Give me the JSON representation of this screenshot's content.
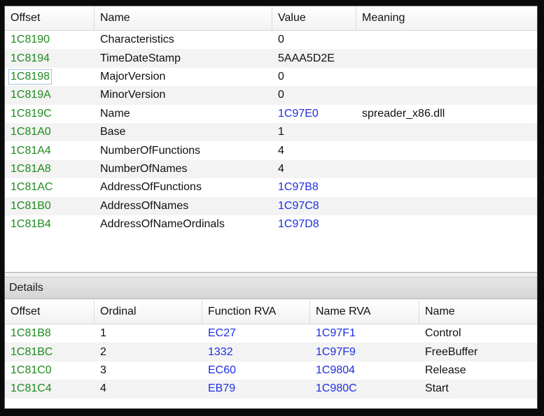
{
  "top_table": {
    "columns": [
      "Offset",
      "Name",
      "Value",
      "Meaning"
    ],
    "rows": [
      {
        "offset": "1C8190",
        "name": "Characteristics",
        "value": "0",
        "meaning": ""
      },
      {
        "offset": "1C8194",
        "name": "TimeDateStamp",
        "value": "5AAA5D2E",
        "meaning": ""
      },
      {
        "offset": "1C8198",
        "name": "MajorVersion",
        "value": "0",
        "meaning": ""
      },
      {
        "offset": "1C819A",
        "name": "MinorVersion",
        "value": "0",
        "meaning": ""
      },
      {
        "offset": "1C819C",
        "name": "Name",
        "value": "1C97E0",
        "meaning": "spreader_x86.dll"
      },
      {
        "offset": "1C81A0",
        "name": "Base",
        "value": "1",
        "meaning": ""
      },
      {
        "offset": "1C81A4",
        "name": "NumberOfFunctions",
        "value": "4",
        "meaning": ""
      },
      {
        "offset": "1C81A8",
        "name": "NumberOfNames",
        "value": "4",
        "meaning": ""
      },
      {
        "offset": "1C81AC",
        "name": "AddressOfFunctions",
        "value": "1C97B8",
        "meaning": ""
      },
      {
        "offset": "1C81B0",
        "name": "AddressOfNames",
        "value": "1C97C8",
        "meaning": ""
      },
      {
        "offset": "1C81B4",
        "name": "AddressOfNameOrdinals",
        "value": "1C97D8",
        "meaning": ""
      }
    ]
  },
  "details_label": "Details",
  "bottom_table": {
    "columns": [
      "Offset",
      "Ordinal",
      "Function RVA",
      "Name RVA",
      "Name"
    ],
    "rows": [
      {
        "offset": "1C81B8",
        "ordinal": "1",
        "function_rva": "EC27",
        "name_rva": "1C97F1",
        "name": "Control"
      },
      {
        "offset": "1C81BC",
        "ordinal": "2",
        "function_rva": "1332",
        "name_rva": "1C97F9",
        "name": "FreeBuffer"
      },
      {
        "offset": "1C81C0",
        "ordinal": "3",
        "function_rva": "EC60",
        "name_rva": "1C9804",
        "name": "Release"
      },
      {
        "offset": "1C81C4",
        "ordinal": "4",
        "function_rva": "EB79",
        "name_rva": "1C980C",
        "name": "Start"
      }
    ]
  },
  "colors": {
    "offset_text": "#1f8a1f",
    "address_text": "#1d2ee0",
    "alt_row": "#f3f3f3"
  }
}
